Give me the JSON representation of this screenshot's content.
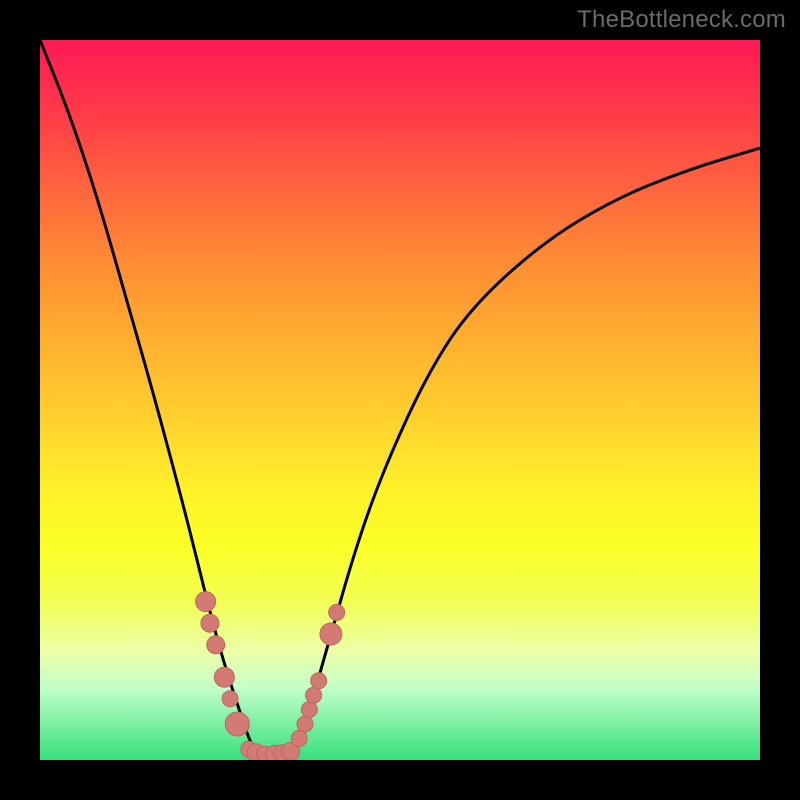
{
  "watermark": {
    "text": "TheBottleneck.com"
  },
  "colors": {
    "curve": "#000000",
    "marker_fill": "#d27b75",
    "marker_stroke": "#c2645e"
  },
  "chart_data": {
    "type": "line",
    "title": "",
    "xlabel": "",
    "ylabel": "",
    "xlim": [
      0,
      100
    ],
    "ylim": [
      0,
      100
    ],
    "series": [
      {
        "name": "bottleneck-curve",
        "x": [
          0,
          4,
          8,
          12,
          16,
          20,
          22,
          24,
          26,
          28,
          29,
          30,
          31,
          32,
          33,
          34,
          35,
          36,
          38,
          40,
          44,
          48,
          54,
          60,
          70,
          80,
          90,
          100
        ],
        "values": [
          100,
          90,
          78,
          64,
          50,
          35,
          27,
          19,
          12,
          6,
          3,
          1,
          0,
          0,
          0,
          0,
          1,
          3,
          9,
          16,
          30,
          41,
          54,
          63,
          72,
          78,
          82,
          85
        ]
      }
    ],
    "markers": {
      "name": "highlighted-points",
      "x": [
        23.0,
        23.6,
        24.4,
        25.6,
        26.4,
        27.4,
        29.0,
        30.0,
        31.2,
        32.6,
        33.6,
        34.8,
        36.0,
        36.8,
        37.4,
        38.0,
        38.7,
        40.4,
        41.2
      ],
      "values": [
        22.0,
        19.0,
        16.0,
        11.5,
        8.5,
        5.0,
        1.5,
        1.0,
        0.8,
        0.8,
        1.0,
        1.2,
        3.0,
        5.0,
        7.0,
        9.0,
        11.0,
        17.5,
        20.5
      ],
      "r": [
        10,
        9,
        9,
        10,
        8,
        12,
        8,
        9,
        8,
        9,
        8,
        9,
        8,
        8,
        8,
        8,
        8,
        11,
        8
      ]
    }
  }
}
